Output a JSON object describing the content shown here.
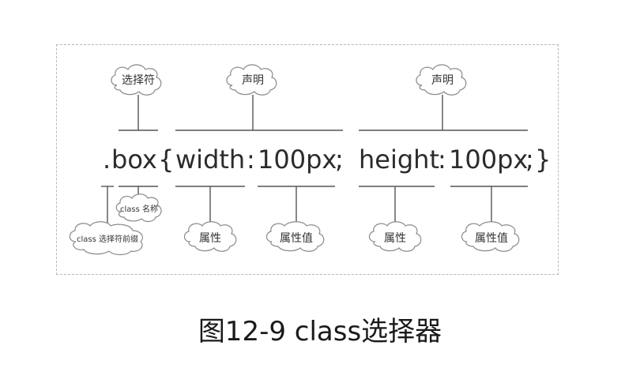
{
  "diagram": {
    "selector_label": "选择符",
    "declaration_label_1": "声明",
    "declaration_label_2": "声明",
    "class_name_label": "class 名称",
    "class_prefix_label": "class 选择符前缀",
    "property_label_1": "属性",
    "value_label_1": "属性值",
    "property_label_2": "属性",
    "value_label_2": "属性值",
    "code": {
      "dot": ".",
      "selector": "box",
      "open_brace": "{",
      "property1": "width",
      "colon1": ":",
      "value1": "100px",
      "semi1": ";",
      "property2": "height",
      "colon2": ":",
      "value2": "100px",
      "semi2": ";",
      "close_brace": "}"
    }
  },
  "caption": "图12-9 class选择器"
}
